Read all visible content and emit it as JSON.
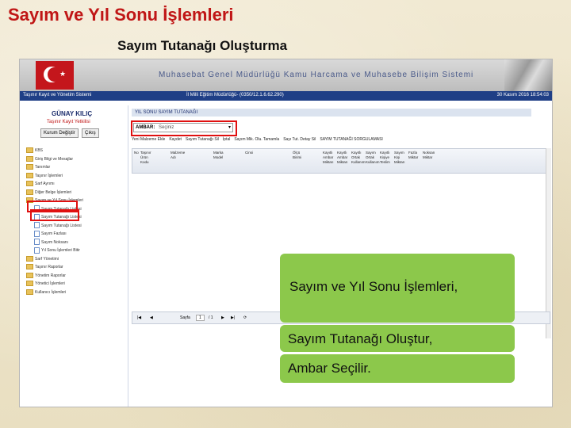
{
  "slide": {
    "title": "Sayım ve Yıl Sonu İşlemleri",
    "subtitle": "Sayım Tutanağı Oluşturma"
  },
  "app": {
    "banner_title": "Muhasebat Genel Müdürlüğü Kamu Harcama ve Muhasebe Bilişim Sistemi",
    "status_left": "Taşınır Kayıt ve Yönetim Sistemi",
    "status_mid": "İl Milli Eğitim Müdürlüğü- (0350/12.1.6.62.290)",
    "status_right": "30 Kasım 2016 18:54:03",
    "user": {
      "name": "GÜNAY KILIÇ",
      "role": "Taşınır Kayıt Yetkilisi",
      "change_button": "Kurum Değiştir",
      "logout_button": "Çıkış"
    },
    "tree": [
      {
        "label": "KBS",
        "type": "folder"
      },
      {
        "label": "Giriş Bilgi ve Mesajlar",
        "type": "folder"
      },
      {
        "label": "Tanımlar",
        "type": "folder"
      },
      {
        "label": "Taşınır İşlemleri",
        "type": "folder"
      },
      {
        "label": "Sarf Ayrımı",
        "type": "folder"
      },
      {
        "label": "Diğer Belge İşlemleri",
        "type": "folder"
      },
      {
        "label": "Sayım ve Yıl Sonu İşlemleri",
        "type": "folder"
      },
      {
        "label": "Sayım Tutanağı Listesi",
        "type": "doc"
      },
      {
        "label": "Sayım Tutanağı Listesi",
        "type": "doc"
      },
      {
        "label": "Sayım Tutanağı Listesi",
        "type": "doc"
      },
      {
        "label": "Sayım Fazlası",
        "type": "doc"
      },
      {
        "label": "Sayım Noksanı",
        "type": "doc"
      },
      {
        "label": "Yıl Sonu İşlemleri Bitir",
        "type": "doc"
      },
      {
        "label": "Sarf Yönetimi",
        "type": "folder"
      },
      {
        "label": "Taşınır Raporlar",
        "type": "folder"
      },
      {
        "label": "Yönetim Raporlar",
        "type": "folder"
      },
      {
        "label": "Yönetici İşlemleri",
        "type": "folder"
      },
      {
        "label": "Kullanıcı İşlemleri",
        "type": "folder"
      }
    ],
    "panel_title": "YIL SONU SAYIM TUTANAĞI",
    "ambar_label": "AMBAR:",
    "ambar_value": "Seçiniz",
    "toolbar": [
      "Yeni Malzeme Ekle",
      "Kaydet",
      "Sayım Tutanağı Sil",
      "İptal",
      "Sayım Mik. Olu. Tamamla",
      "Sayı Tut. Detay Sil",
      "SAYIM TUTANAĞI SORGULAMASI"
    ],
    "grid_headers": [
      "No",
      "Taşınır Ürün Kodu",
      "Malzeme Adı",
      "Marka Model",
      "Cinsi",
      "Ölçü Birimi",
      "Kayıtlı Ambar Miktarı",
      "Kayıtlı Ambar Miktarı",
      "Kayıtlı Ortak Kullanım",
      "Sayım Ortak Kullanım",
      "Kayıtlı Kişiye Teslim",
      "Sayım Kişi Miktarı",
      "Fazla Miktar",
      "Noksan Miktar"
    ],
    "pager": {
      "page_label": "Sayfa",
      "page_value": "1",
      "of": "/ 1"
    }
  },
  "notes": [
    "Sayım ve Yıl Sonu İşlemleri,",
    "Sayım Tutanağı Oluştur,",
    "Ambar Seçilir."
  ]
}
